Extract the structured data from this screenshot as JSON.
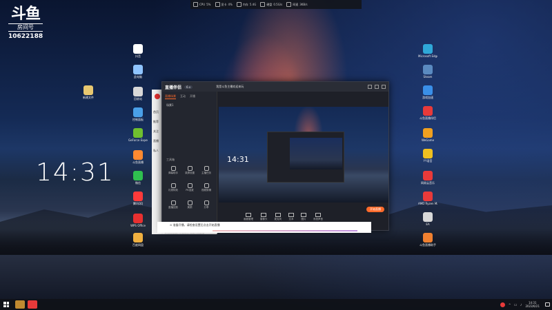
{
  "overlay": {
    "logo": "斗鱼",
    "room_label": "房间号",
    "room_number": "10622188"
  },
  "desktop": {
    "clock": "14:31",
    "left_icons": [
      {
        "label": "新建文件",
        "icon": "folder-icon",
        "color": "#e8c870"
      }
    ],
    "column1_icons": [
      {
        "label": "抖音",
        "icon": "app-icon",
        "color": "#ffffff"
      },
      {
        "label": "此电脑",
        "icon": "computer-icon",
        "color": "#8fc4ff"
      },
      {
        "label": "回收站",
        "icon": "recycle-bin-icon",
        "color": "#d8d8d8"
      },
      {
        "label": "控制面板",
        "icon": "control-panel-icon",
        "color": "#4aa0e8"
      },
      {
        "label": "GeForce Experience",
        "icon": "nvidia-icon",
        "color": "#6fbf2f"
      },
      {
        "label": "斗鱼直播",
        "icon": "douyu-icon",
        "color": "#ff8a30"
      },
      {
        "label": "微信",
        "icon": "wechat-icon",
        "color": "#2fbf4f"
      },
      {
        "label": "腾讯QQ",
        "icon": "qq-icon",
        "color": "#ff3a3a"
      },
      {
        "label": "WPS Office",
        "icon": "wps-icon",
        "color": "#e83030"
      },
      {
        "label": "百度网盘",
        "icon": "cloud-icon",
        "color": "#f0b040"
      }
    ],
    "right_icons": [
      {
        "label": "Microsoft Edge",
        "icon": "edge-icon",
        "color": "#2fa8d8"
      },
      {
        "label": "Steam",
        "icon": "steam-icon",
        "color": "#5a8ac0"
      },
      {
        "label": "游戏加速",
        "icon": "game-icon",
        "color": "#3a8fe8"
      },
      {
        "label": "斗鱼直播伴侣",
        "icon": "douyu-companion-icon",
        "color": "#e83a3a"
      },
      {
        "label": "WeGame",
        "icon": "wegame-icon",
        "color": "#f0a020"
      },
      {
        "label": "YY语音",
        "icon": "yy-icon",
        "color": "#f0c020"
      },
      {
        "label": "网易云音乐",
        "icon": "music-icon",
        "color": "#e83a3a"
      },
      {
        "label": "AMD Ryzen Master",
        "icon": "amd-icon",
        "color": "#e83a3a"
      },
      {
        "label": "EA",
        "icon": "ea-icon",
        "color": "#d8d8d8"
      },
      {
        "label": "斗鱼直播助手",
        "icon": "helper-icon",
        "color": "#f08030"
      }
    ]
  },
  "perfbar": {
    "items": [
      {
        "label": "CPU",
        "value": "5%"
      },
      {
        "label": "显卡",
        "value": "4%"
      },
      {
        "label": "内存",
        "value": "5.4G"
      },
      {
        "label": "硬盘",
        "value": "0.5G/s"
      },
      {
        "label": "网速",
        "value": "3KB/s"
      }
    ]
  },
  "phone": {
    "items": [
      "首页",
      "推荐",
      "关注",
      "直播",
      "私人"
    ]
  },
  "companion": {
    "brand": "直播伴侣",
    "version_badge": "6.x",
    "room_title": "我是斗鱼主播欢迎来玩",
    "tabs": [
      "直播场景",
      "互动",
      "开播"
    ],
    "scene_label": "场景1",
    "tools_label": "工具箱",
    "tools": [
      "弹幕助手",
      "录屏设置",
      "主播任务",
      "礼物特效",
      "PK连麦",
      "视频剪辑",
      "直播回放",
      "美颜",
      "分享"
    ],
    "bottom_buttons": [
      "画面管理",
      "摄像头",
      "麦克风",
      "文本",
      "图片",
      "系统声音"
    ],
    "live_button": "开始直播",
    "status_text": "8 小时在线，不足以上 需要开启直播"
  },
  "status_line": {
    "text": "⊙ 准备开播，请检查设置后点击开始直播"
  },
  "taskbar": {
    "time": "14:31",
    "date": "2023/6/21"
  }
}
